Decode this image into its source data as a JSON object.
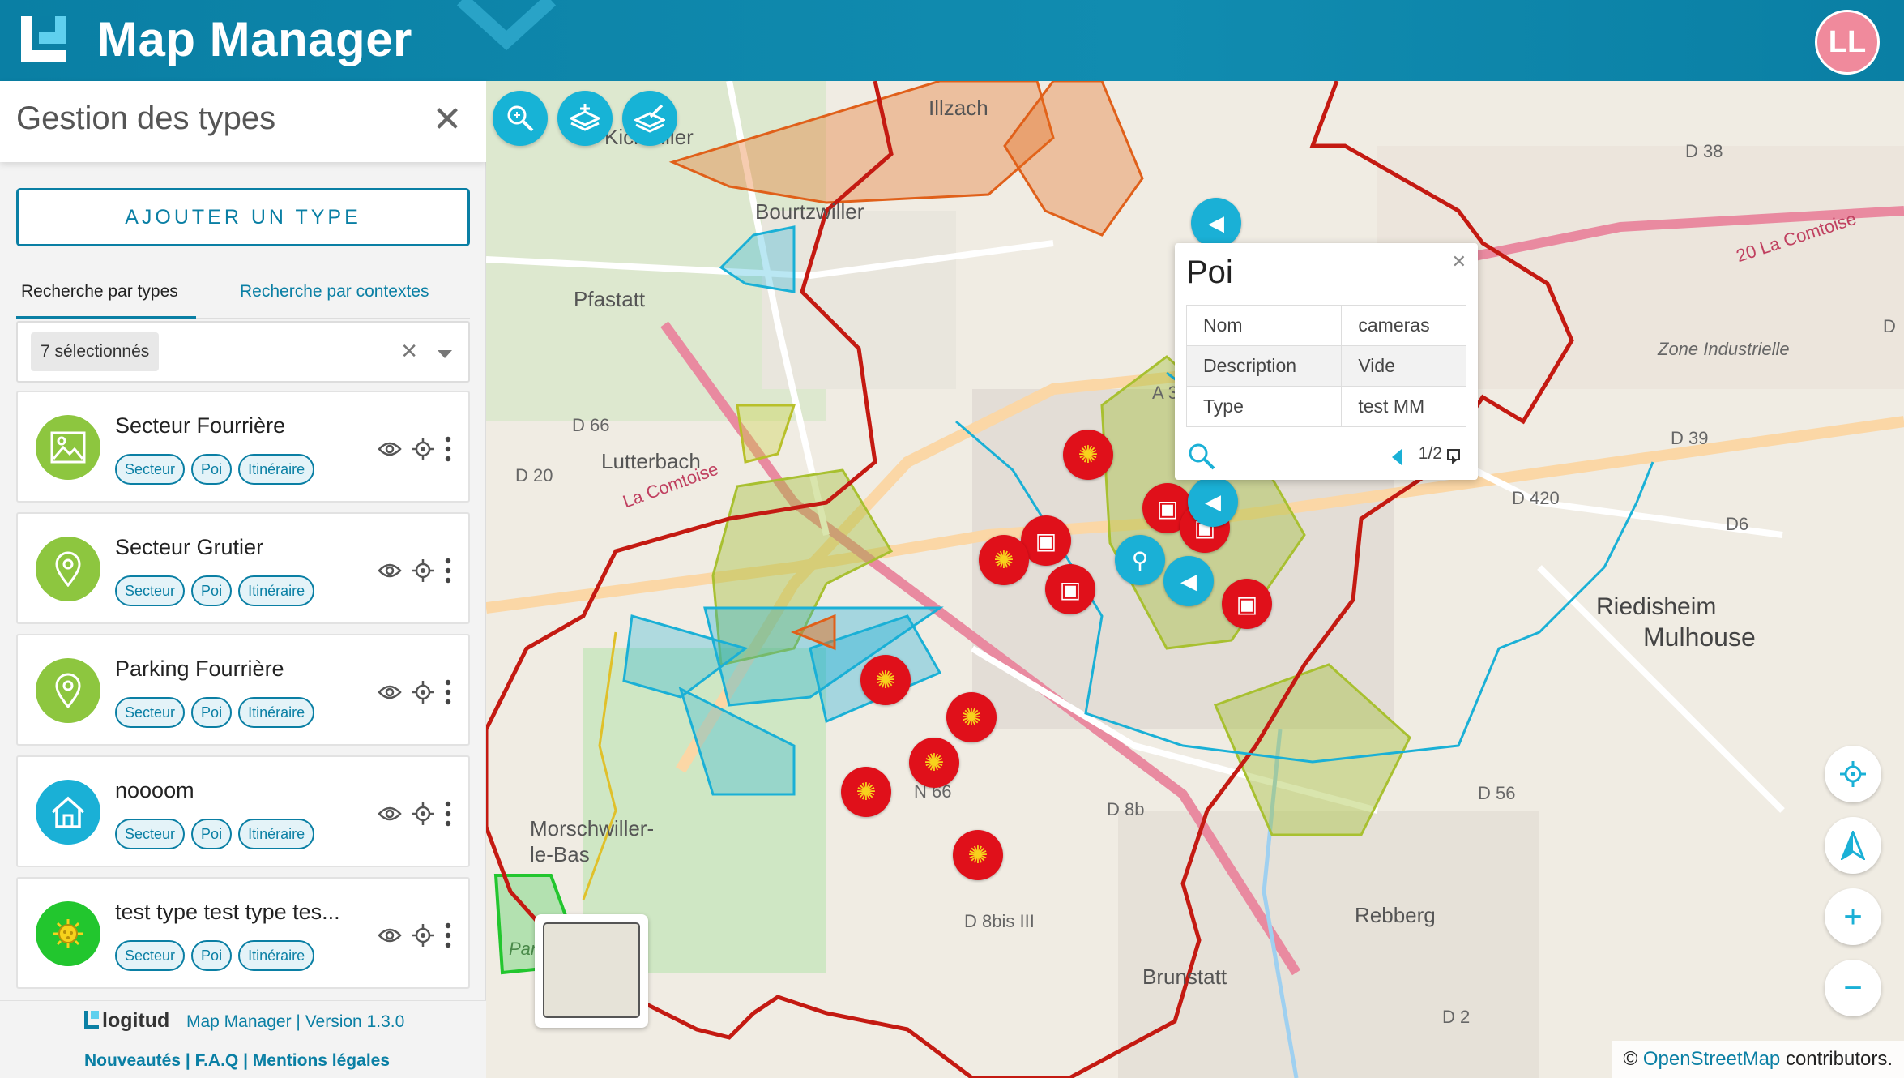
{
  "header": {
    "title": "Map Manager",
    "avatar_initials": "LL"
  },
  "sidebar": {
    "title": "Gestion des types",
    "add_button": "AJOUTER UN TYPE",
    "tabs": [
      {
        "label": "Recherche par types"
      },
      {
        "label": "Recherche par contextes"
      }
    ],
    "filter_chip": "7 sélectionnés",
    "types": [
      {
        "name": "Secteur Fourrière",
        "icon": "image-icon",
        "color": "#8dc63f",
        "tags": [
          "Secteur",
          "Poi",
          "Itinéraire"
        ]
      },
      {
        "name": "Secteur Grutier",
        "icon": "map-pin-icon",
        "color": "#8dc63f",
        "tags": [
          "Secteur",
          "Poi",
          "Itinéraire"
        ]
      },
      {
        "name": "Parking Fourrière",
        "icon": "map-pin-icon",
        "color": "#8dc63f",
        "tags": [
          "Secteur",
          "Poi",
          "Itinéraire"
        ]
      },
      {
        "name": "noooom",
        "icon": "home-icon",
        "color": "#1ab0d6",
        "tags": [
          "Secteur",
          "Poi",
          "Itinéraire"
        ]
      },
      {
        "name": "test type test type tes...",
        "icon": "virus-icon",
        "color": "#22c62e",
        "tags": [
          "Secteur",
          "Poi",
          "Itinéraire"
        ]
      }
    ],
    "footer": {
      "brand": "logitud",
      "version": "Map Manager | Version 1.3.0",
      "links": "Nouveautés | F.A.Q | Mentions légales"
    }
  },
  "popup": {
    "title": "Poi",
    "rows": [
      {
        "key": "Nom",
        "value": "cameras"
      },
      {
        "key": "Description",
        "value": "Vide"
      },
      {
        "key": "Type",
        "value": "test MM"
      }
    ],
    "pager": "1/2"
  },
  "map": {
    "labels": [
      "Illzach",
      "Pfastatt",
      "Lutterbach",
      "Bourtzwiller",
      "Kichwiller",
      "Zone Industrielle",
      "Mulhouse",
      "Riedisheim",
      "Morschwiller-le-Bas",
      "Rebberg",
      "Brunstatt",
      "D 38",
      "D 66",
      "D 20",
      "D 39",
      "D 420",
      "D6",
      "D 8b",
      "D 56",
      "D 8bis III",
      "N 66",
      "D 2",
      "A 3",
      "La Comtoise",
      "20 La Comtoise",
      "Parc des Collines",
      "D"
    ],
    "attribution_prefix": "©",
    "attribution_link": "OpenStreetMap",
    "attribution_suffix": "contributors."
  },
  "colors": {
    "primary": "#0a7fa4",
    "accent": "#1ab0d6",
    "red_marker": "#e0101a",
    "green_type": "#8dc63f"
  }
}
